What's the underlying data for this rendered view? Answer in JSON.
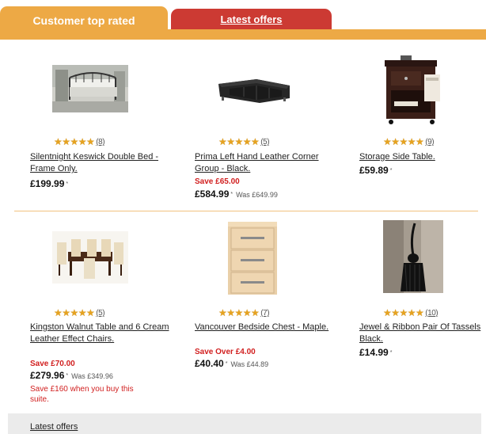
{
  "tabs": {
    "active_label": "Customer top rated",
    "inactive_label": "Latest offers"
  },
  "colors": {
    "accent": "#eda945",
    "tab_red": "#cc3a33",
    "save_red": "#d11f1f"
  },
  "products": [
    {
      "name": "Silentnight Keswick Double Bed - Frame Only.",
      "rating_stars": 5,
      "review_count": "(8)",
      "price": "£199.99",
      "price_marker": "*",
      "save": "",
      "was": "",
      "bundle_note": "",
      "icon": "bed-image"
    },
    {
      "name": "Prima Left Hand Leather Corner Group - Black.",
      "rating_stars": 5,
      "review_count": "(5)",
      "price": "£584.99",
      "price_marker": "*",
      "save": "Save £65.00",
      "was": "Was £649.99",
      "bundle_note": "",
      "icon": "sofa-image"
    },
    {
      "name": "Storage Side Table.",
      "rating_stars": 5,
      "review_count": "(9)",
      "price": "£59.89",
      "price_marker": "*",
      "save": "",
      "was": "",
      "bundle_note": "",
      "icon": "side-table-image"
    },
    {
      "name": "Kingston Walnut Table and 6 Cream Leather Effect Chairs.",
      "rating_stars": 5,
      "review_count": "(5)",
      "price": "£279.96",
      "price_marker": "*",
      "save": "Save £70.00",
      "was": "Was £349.96",
      "bundle_note": "Save £160 when you buy this suite.",
      "icon": "dining-set-image"
    },
    {
      "name": "Vancouver Bedside Chest - Maple.",
      "rating_stars": 5,
      "review_count": "(7)",
      "price": "£40.40",
      "price_marker": "*",
      "save": "Save Over £4.00",
      "was": "Was £44.89",
      "bundle_note": "",
      "icon": "bedside-chest-image"
    },
    {
      "name": "Jewel & Ribbon Pair Of Tassels Black.",
      "rating_stars": 5,
      "review_count": "(10)",
      "price": "£14.99",
      "price_marker": "*",
      "save": "",
      "was": "",
      "bundle_note": "",
      "icon": "tassel-image"
    }
  ],
  "footer": {
    "link_label": "Latest offers"
  }
}
